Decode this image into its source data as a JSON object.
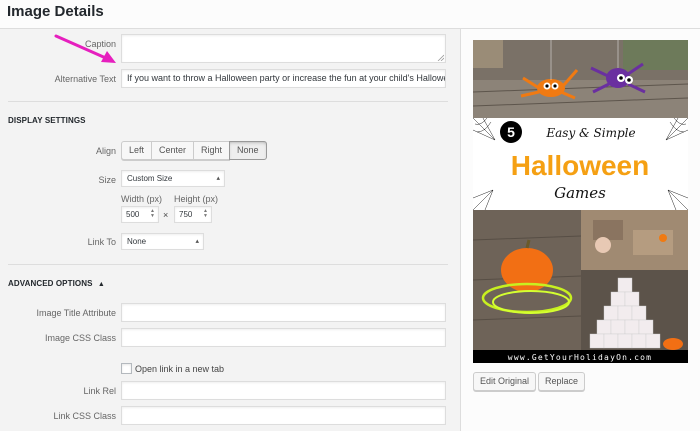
{
  "header": {
    "title": "Image Details"
  },
  "fields": {
    "caption_label": "Caption",
    "caption_value": "",
    "alt_label": "Alternative Text",
    "alt_value": "If you want to throw a Halloween party or increase the fun at your child's Halloween ba"
  },
  "display": {
    "title": "DISPLAY SETTINGS",
    "align_label": "Align",
    "align_options": [
      "Left",
      "Center",
      "Right",
      "None"
    ],
    "align_selected": "None",
    "size_label": "Size",
    "size_value": "Custom Size",
    "width_label": "Width (px)",
    "height_label": "Height (px)",
    "width_value": "500",
    "height_value": "750",
    "times": "×",
    "link_label": "Link To",
    "link_value": "None"
  },
  "advanced": {
    "title": "ADVANCED OPTIONS",
    "toggle": "▲",
    "title_attr_label": "Image Title Attribute",
    "title_attr_value": "",
    "css_class_label": "Image CSS Class",
    "css_class_value": "",
    "new_tab_label": "Open link in a new tab",
    "new_tab_checked": false,
    "link_rel_label": "Link Rel",
    "link_rel_value": "",
    "link_css_label": "Link CSS Class",
    "link_css_value": ""
  },
  "preview": {
    "badge_number": "5",
    "line1": "Easy & Simple",
    "line2": "Halloween",
    "line3": "Games",
    "site_url": "www.GetYourHolidayOn.com",
    "edit_button": "Edit Original",
    "replace_button": "Replace"
  },
  "colors": {
    "accent_arrow": "#e61fbe",
    "title_orange": "#f5a013",
    "badge": "#000000"
  }
}
